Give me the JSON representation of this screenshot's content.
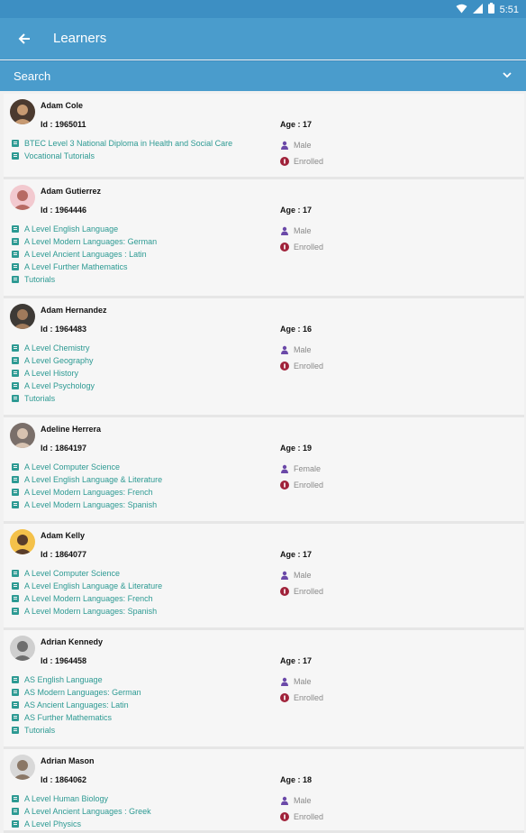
{
  "status": {
    "time": "5:51"
  },
  "appbar": {
    "title": "Learners"
  },
  "search": {
    "label": "Search"
  },
  "colors": {
    "primary": "#4a9ccc",
    "course_link": "#2d9a93",
    "gender_icon": "#6b49a8",
    "enrolled_icon": "#a0223a"
  },
  "learners": [
    {
      "name": "Adam Cole",
      "id": "Id : 1965011",
      "age": "Age : 17",
      "gender": "Male",
      "status": "Enrolled",
      "courses": [
        "BTEC Level 3 National Diploma in Health and Social Care",
        "Vocational Tutorials"
      ]
    },
    {
      "name": "Adam Gutierrez",
      "id": "Id : 1964446",
      "age": "Age : 17",
      "gender": "Male",
      "status": "Enrolled",
      "courses": [
        "A Level English Language",
        "A Level Modern Languages: German",
        "A Level Ancient Languages : Latin",
        "A Level Further Mathematics",
        "Tutorials"
      ]
    },
    {
      "name": "Adam Hernandez",
      "id": "Id : 1964483",
      "age": "Age : 16",
      "gender": "Male",
      "status": "Enrolled",
      "courses": [
        "A Level Chemistry",
        "A Level Geography",
        "A Level History",
        "A Level Psychology",
        "Tutorials"
      ]
    },
    {
      "name": "Adeline Herrera",
      "id": "Id : 1864197",
      "age": "Age : 19",
      "gender": "Female",
      "status": "Enrolled",
      "courses": [
        "A Level Computer Science",
        "A Level English Language & Literature",
        "A Level Modern Languages: French",
        "A Level Modern Languages: Spanish"
      ]
    },
    {
      "name": "Adam Kelly",
      "id": "Id : 1864077",
      "age": "Age : 17",
      "gender": "Male",
      "status": "Enrolled",
      "courses": [
        "A Level Computer Science",
        "A Level English Language & Literature",
        "A Level Modern Languages: French",
        "A Level Modern Languages: Spanish"
      ]
    },
    {
      "name": "Adrian Kennedy",
      "id": "Id : 1964458",
      "age": "Age : 17",
      "gender": "Male",
      "status": "Enrolled",
      "courses": [
        "AS English Language",
        "AS Modern Languages: German",
        "AS Ancient Languages: Latin",
        "AS Further Mathematics",
        "Tutorials"
      ]
    },
    {
      "name": "Adrian Mason",
      "id": "Id : 1864062",
      "age": "Age : 18",
      "gender": "Male",
      "status": "Enrolled",
      "courses": [
        "A Level Human Biology",
        "A Level Ancient Languages : Greek",
        "A Level Physics"
      ]
    }
  ]
}
